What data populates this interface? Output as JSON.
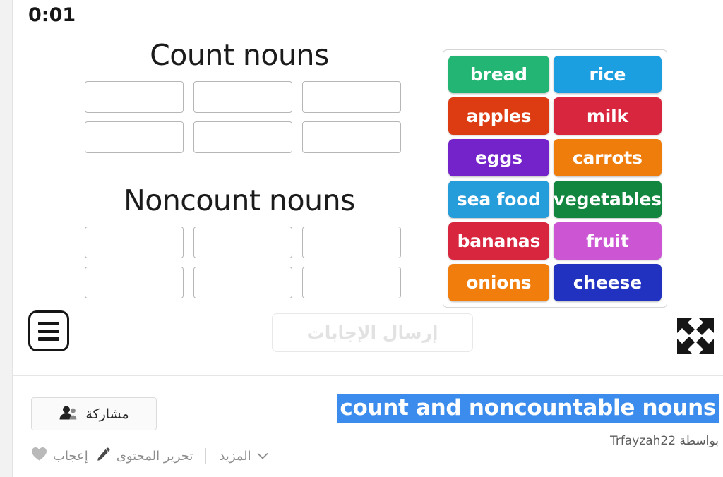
{
  "timer": "0:01",
  "categories": [
    {
      "title": "Count nouns",
      "slots": 6
    },
    {
      "title": "Noncount nouns",
      "slots": 6
    }
  ],
  "wordbank": {
    "tiles": [
      {
        "label": "bread",
        "color": "#22b573"
      },
      {
        "label": "rice",
        "color": "#1b9fe0"
      },
      {
        "label": "apples",
        "color": "#dd3b12"
      },
      {
        "label": "milk",
        "color": "#d8263f"
      },
      {
        "label": "eggs",
        "color": "#7323c9"
      },
      {
        "label": "carrots",
        "color": "#ef7d0c"
      },
      {
        "label": "sea food",
        "color": "#259ddb"
      },
      {
        "label": "vegetables",
        "color": "#12853f"
      },
      {
        "label": "bananas",
        "color": "#d8263f"
      },
      {
        "label": "fruit",
        "color": "#cc55d4"
      },
      {
        "label": "onions",
        "color": "#f07d0c"
      },
      {
        "label": "cheese",
        "color": "#2132c0"
      }
    ]
  },
  "controls": {
    "menu_icon": "hamburger-menu-icon",
    "submit_label": "إرسال الإجابات",
    "fullscreen_icon": "fullscreen-expand-icon"
  },
  "footer": {
    "share_label": "مشاركة",
    "share_icon": "person-share-icon",
    "actions": [
      {
        "label": "إعجاب",
        "icon": "heart-icon"
      },
      {
        "label": "تحرير المحتوى",
        "icon": "pencil-icon"
      },
      {
        "label": "المزيد",
        "icon": "chevron-down-icon"
      }
    ],
    "title": "count and noncountable nouns",
    "title_highlight_color": "#3b8cec",
    "byline_prefix": "بواسطة",
    "byline_author": "Trfayzah22"
  }
}
